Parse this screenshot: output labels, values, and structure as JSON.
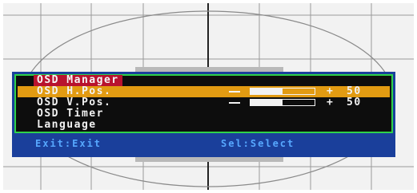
{
  "osd": {
    "title": "OSD Manager",
    "items": [
      {
        "label": "OSD H.Pos.",
        "selected": true,
        "has_slider": true,
        "minus": "—",
        "plus": "+",
        "value": "50",
        "level": 0.5
      },
      {
        "label": "OSD V.Pos.",
        "selected": false,
        "has_slider": true,
        "minus": "—",
        "plus": "+",
        "value": "50",
        "level": 0.5
      },
      {
        "label": "OSD Timer",
        "selected": false,
        "has_slider": false
      },
      {
        "label": "Language",
        "selected": false,
        "has_slider": false
      }
    ],
    "footer": {
      "exit_label": "Exit:Exit",
      "select_label": "Sel:Select"
    }
  },
  "colors": {
    "panel": "#1a3f9b",
    "border": "#2fd24a",
    "title_bg": "#b8122e",
    "highlight": "#e29b12",
    "footer_text": "#57a8ff"
  }
}
